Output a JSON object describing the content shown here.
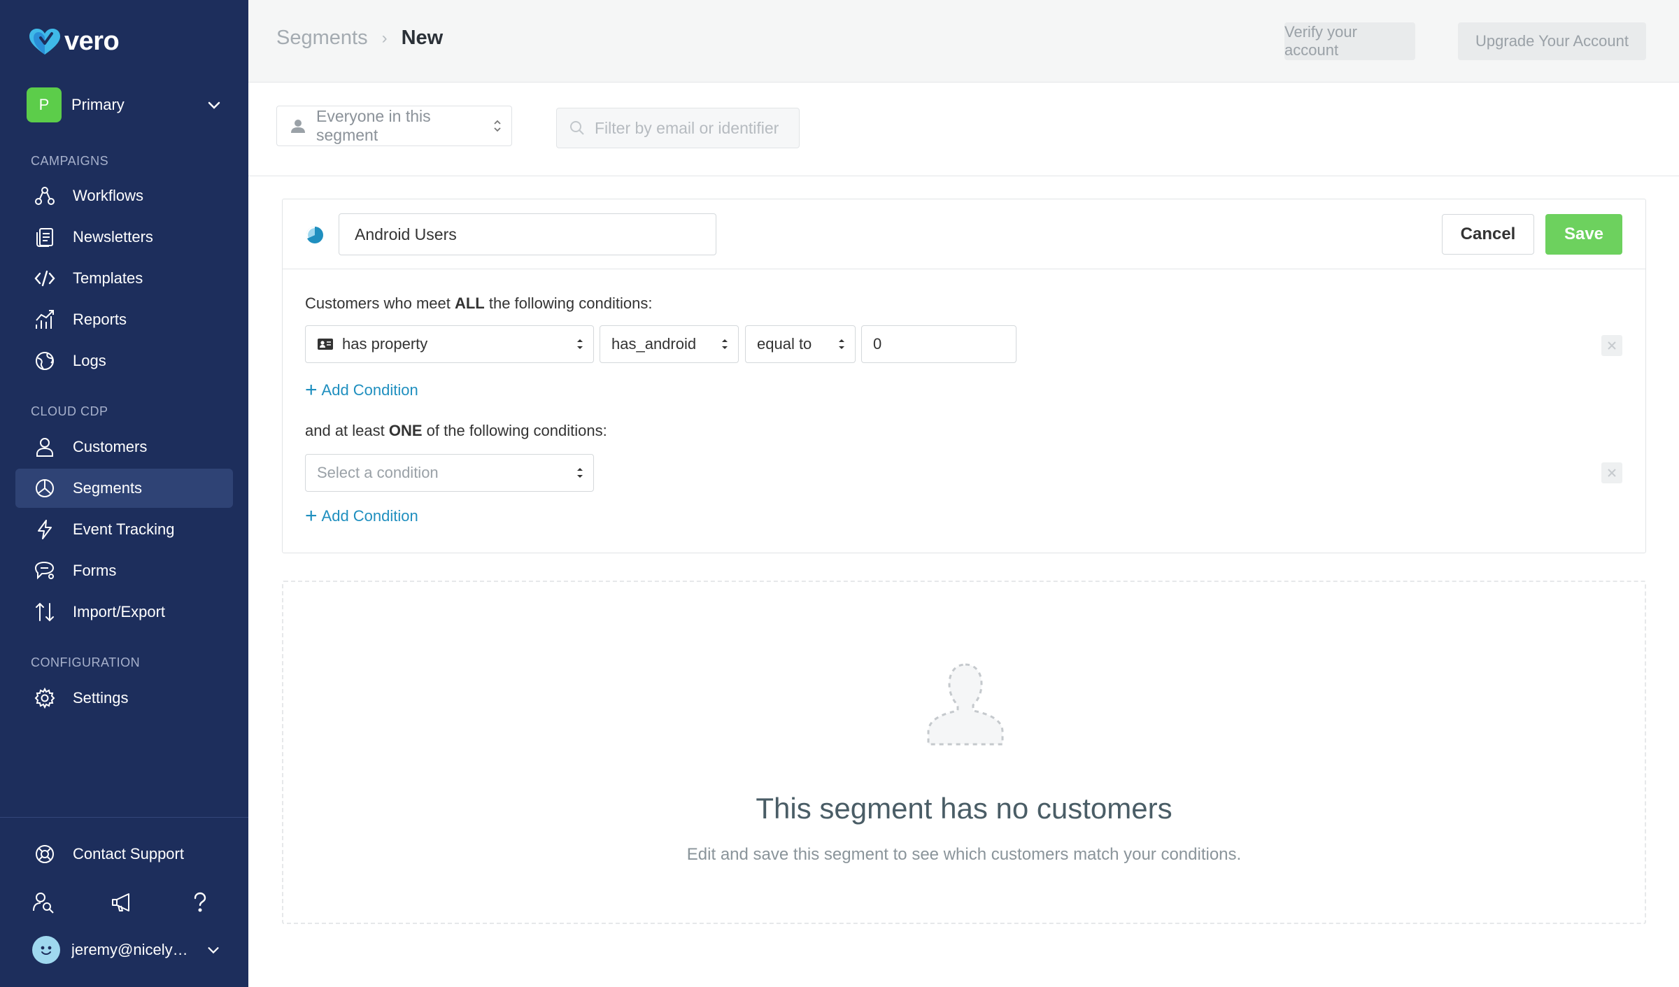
{
  "app": {
    "logo_text": "vero"
  },
  "workspace": {
    "badge": "P",
    "name": "Primary"
  },
  "sidebar": {
    "campaigns_title": "CAMPAIGNS",
    "campaigns": [
      {
        "label": "Workflows",
        "icon": "workflows-icon"
      },
      {
        "label": "Newsletters",
        "icon": "newsletters-icon"
      },
      {
        "label": "Templates",
        "icon": "code-icon"
      },
      {
        "label": "Reports",
        "icon": "reports-icon"
      },
      {
        "label": "Logs",
        "icon": "globe-icon"
      }
    ],
    "cdp_title": "CLOUD CDP",
    "cdp": [
      {
        "label": "Customers",
        "icon": "user-icon"
      },
      {
        "label": "Segments",
        "icon": "segments-icon",
        "active": true
      },
      {
        "label": "Event Tracking",
        "icon": "lightning-icon"
      },
      {
        "label": "Forms",
        "icon": "chat-icon"
      },
      {
        "label": "Import/Export",
        "icon": "import-export-icon"
      }
    ],
    "config_title": "CONFIGURATION",
    "config": [
      {
        "label": "Settings",
        "icon": "gear-icon"
      }
    ],
    "support_label": "Contact Support",
    "user_name": "jeremy@nicely…"
  },
  "header": {
    "breadcrumb_parent": "Segments",
    "breadcrumb_current": "New",
    "verify_label": "Verify your account",
    "upgrade_label": "Upgrade Your Account"
  },
  "filter": {
    "segment_select": "Everyone in this segment",
    "search_placeholder": "Filter by email or identifier"
  },
  "editor": {
    "segment_name": "Android Users",
    "cancel_label": "Cancel",
    "save_label": "Save",
    "all_prefix": "Customers who meet ",
    "all_keyword": "ALL",
    "all_suffix": " the following conditions:",
    "condition": {
      "type": "has property",
      "property": "has_android",
      "operator": "equal to",
      "value": "0"
    },
    "add_condition_label": "Add Condition",
    "one_prefix": "and at least ",
    "one_keyword": "ONE",
    "one_suffix": " of the following conditions:",
    "select_placeholder": "Select a condition"
  },
  "empty_state": {
    "title": "This segment has no customers",
    "subtitle": "Edit and save this segment to see which customers match your conditions."
  },
  "colors": {
    "sidebar_bg": "#1d2e5c",
    "active_item": "#2f4375",
    "save_green": "#6dd15e",
    "link_blue": "#1f8fbf",
    "badge_green": "#5ccd4a"
  }
}
